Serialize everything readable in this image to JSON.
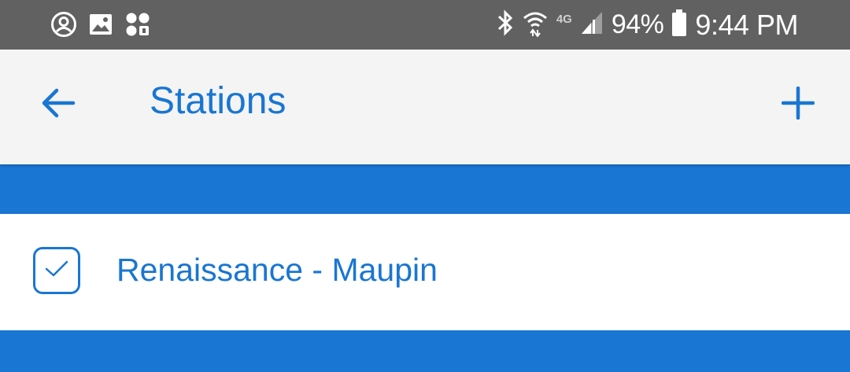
{
  "status_bar": {
    "left_icons": [
      "account-circle-icon",
      "image-icon",
      "secure-folder-icon"
    ],
    "right_icons": [
      "bluetooth-icon",
      "wifi-icon",
      "network-4g-icon",
      "signal-icon"
    ],
    "network_type": "4G",
    "battery_percent": "94%",
    "time": "9:44 PM"
  },
  "app_bar": {
    "title": "Stations",
    "back_icon": "arrow-left-icon",
    "add_icon": "plus-icon"
  },
  "stations": [
    {
      "name": "Renaissance - Maupin",
      "checked": true
    }
  ],
  "colors": {
    "accent": "#1976d2",
    "status_bar_bg": "#616161",
    "app_bar_bg": "#f4f4f4"
  }
}
